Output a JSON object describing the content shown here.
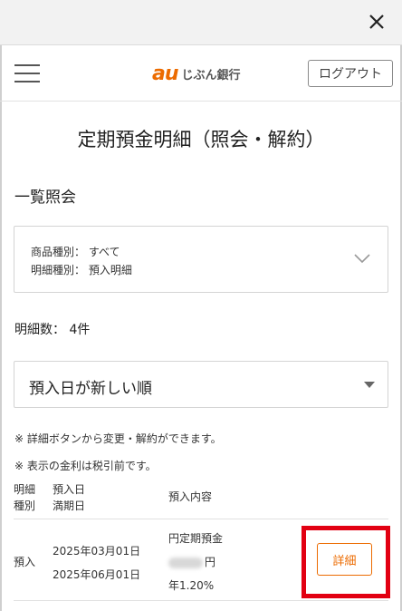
{
  "header": {
    "logo_au": "au",
    "logo_name": "じぶん銀行",
    "logout_label": "ログアウト"
  },
  "page_title": "定期預金明細（照会・解約）",
  "section_title": "一覧照会",
  "filter": {
    "product_type": "商品種別： すべて",
    "detail_type": "明細種別： 預入明細"
  },
  "count_text": "明細数： 4件",
  "sort": {
    "selected": "預入日が新しい順"
  },
  "notes": [
    "※  詳細ボタンから変更・解約ができます。",
    "※  表示の金利は税引前です。"
  ],
  "table": {
    "headers": {
      "type_1": "明細",
      "type_2": "種別",
      "date_1": "預入日",
      "date_2": "満期日",
      "content": "預入内容"
    },
    "rows": [
      {
        "type": "預入",
        "deposit_date": "2025年03月01日",
        "maturity_date": "2025年06月01日",
        "product": "円定期預金",
        "amount_suffix": "円",
        "rate": "年1.20%",
        "detail_label": "詳細"
      }
    ]
  },
  "colors": {
    "accent": "#ec6b00",
    "highlight": "#e20012"
  },
  "icons": {
    "close": "close-icon",
    "menu": "hamburger-menu-icon",
    "chevron": "chevron-down-icon",
    "caret": "caret-down-icon"
  }
}
